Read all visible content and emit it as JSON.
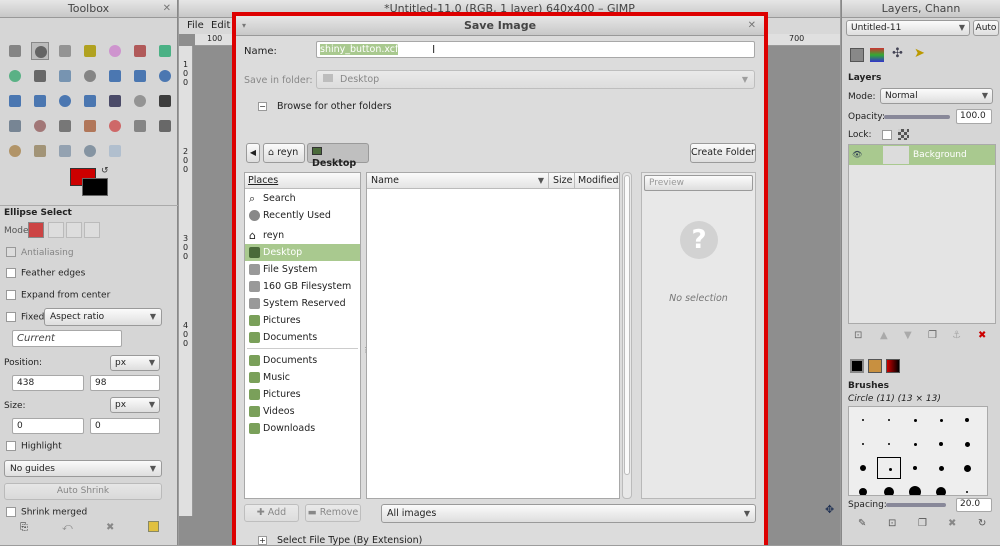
{
  "toolbox": {
    "title": "Toolbox",
    "tool_options_title": "Ellipse Select",
    "mode_label": "Mode:",
    "antialiasing_label": "Antialiasing",
    "feather_label": "Feather edges",
    "expand_label": "Expand from center",
    "fixed_label": "Fixed:",
    "fixed_value": "Aspect ratio",
    "current_value": "Current",
    "position_label": "Position:",
    "position_unit": "px",
    "pos_x": "438",
    "pos_y": "98",
    "size_label": "Size:",
    "size_unit": "px",
    "size_w": "0",
    "size_h": "0",
    "highlight_label": "Highlight",
    "guides_value": "No guides",
    "auto_shrink_label": "Auto Shrink",
    "shrink_merged_label": "Shrink merged",
    "fg_color": "#cc0000",
    "bg_color": "#000000"
  },
  "image_window": {
    "title": "*Untitled-11.0 (RGB, 1 layer) 640x400 – GIMP",
    "menu_file": "File",
    "menu_edit": "Edit",
    "ruler_left": "100",
    "ruler_right": "700",
    "vruler": [
      "1",
      "0",
      "0",
      "2",
      "0",
      "0",
      "3",
      "0",
      "0",
      "4",
      "0",
      "0"
    ]
  },
  "dialog": {
    "title": "Save Image",
    "name_label": "Name:",
    "name_value": "shiny_button.xcf",
    "save_in_label": "Save in folder:",
    "save_in_value": "Desktop",
    "browse_label": "Browse for other folders",
    "crumbs": [
      "reyn",
      "Desktop"
    ],
    "create_folder_label": "Create Folder",
    "places_header": "Places",
    "places": [
      {
        "label": "Search",
        "icon": "search-icon",
        "color": "#777777"
      },
      {
        "label": "Recently Used",
        "icon": "clock-icon",
        "color": "#888888"
      },
      {
        "label": "reyn",
        "icon": "home-icon",
        "color": "#555555"
      },
      {
        "label": "Desktop",
        "icon": "desktop-icon",
        "color": "#4a6a3a"
      },
      {
        "label": "File System",
        "icon": "drive-icon",
        "color": "#999999"
      },
      {
        "label": "160 GB Filesystem",
        "icon": "drive-icon",
        "color": "#999999"
      },
      {
        "label": "System Reserved",
        "icon": "drive-icon",
        "color": "#999999"
      },
      {
        "label": "Pictures",
        "icon": "folder-icon",
        "color": "#7aa05a"
      },
      {
        "label": "Documents",
        "icon": "folder-icon",
        "color": "#7aa05a"
      }
    ],
    "bookmarks": [
      {
        "label": "Documents",
        "icon": "folder-icon",
        "color": "#7aa05a"
      },
      {
        "label": "Music",
        "icon": "folder-icon",
        "color": "#7aa05a"
      },
      {
        "label": "Pictures",
        "icon": "folder-icon",
        "color": "#7aa05a"
      },
      {
        "label": "Videos",
        "icon": "folder-icon",
        "color": "#7aa05a"
      },
      {
        "label": "Downloads",
        "icon": "folder-icon",
        "color": "#7aa05a"
      }
    ],
    "col_name": "Name",
    "col_size": "Size",
    "col_modified": "Modified",
    "preview_label": "Preview",
    "no_selection": "No selection",
    "add_label": "Add",
    "remove_label": "Remove",
    "filter_value": "All images",
    "file_type_label": "Select File Type (By Extension)"
  },
  "layers": {
    "title": "Layers, Chann",
    "image_select": "Untitled-11",
    "auto_label": "Auto",
    "panel_title": "Layers",
    "mode_label": "Mode:",
    "mode_value": "Normal",
    "opacity_label": "Opacity:",
    "opacity_value": "100.0",
    "lock_label": "Lock:",
    "layer_name": "Background",
    "brushes_title": "Brushes",
    "brush_desc": "Circle (11) (13 × 13)",
    "spacing_label": "Spacing:",
    "spacing_value": "20.0"
  },
  "colors": {
    "accent": "#a9c98f",
    "dialog_border": "#dd0000"
  }
}
